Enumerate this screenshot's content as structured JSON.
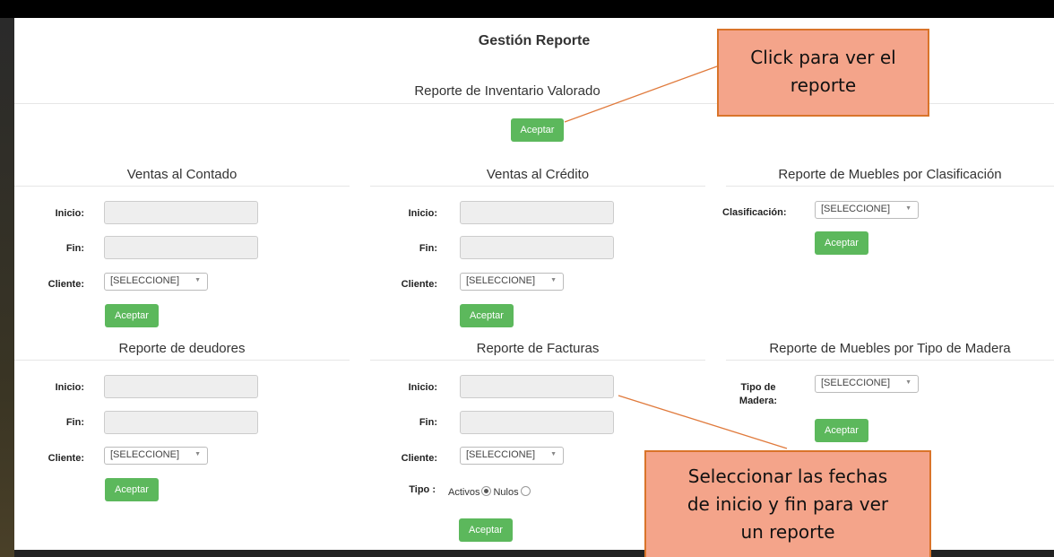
{
  "page": {
    "title": "Gestión Reporte",
    "inventario": {
      "title": "Reporte de Inventario Valorado",
      "button": "Aceptar"
    }
  },
  "sections": {
    "contado": {
      "title": "Ventas al Contado",
      "inicio": "Inicio:",
      "fin": "Fin:",
      "cliente": "Cliente:",
      "select": "[SELECCIONE]",
      "button": "Aceptar"
    },
    "credito": {
      "title": "Ventas al Crédito",
      "inicio": "Inicio:",
      "fin": "Fin:",
      "cliente": "Cliente:",
      "select": "[SELECCIONE]",
      "button": "Aceptar"
    },
    "clasificacion": {
      "title": "Reporte de Muebles por Clasificación",
      "label": "Clasificación:",
      "select": "[SELECCIONE]",
      "button": "Aceptar"
    },
    "deudores": {
      "title": "Reporte de deudores",
      "inicio": "Inicio:",
      "fin": "Fin:",
      "cliente": "Cliente:",
      "select": "[SELECCIONE]",
      "button": "Aceptar"
    },
    "facturas": {
      "title": "Reporte de Facturas",
      "inicio": "Inicio:",
      "fin": "Fin:",
      "cliente": "Cliente:",
      "select": "[SELECCIONE]",
      "tipo_label": "Tipo :",
      "activos": "Activos",
      "nulos": "Nulos",
      "button": "Aceptar"
    },
    "madera": {
      "title": "Reporte de Muebles por Tipo de Madera",
      "label_line1": "Tipo de",
      "label_line2": "Madera:",
      "select": "[SELECCIONE]",
      "button": "Aceptar"
    }
  },
  "callouts": {
    "ver_reporte": {
      "line1": "Click para ver el",
      "line2": "reporte"
    },
    "fechas": {
      "line1": "Seleccionar las fechas",
      "line2": "de inicio y fin para ver",
      "line3": "un reporte"
    }
  },
  "colors": {
    "button": "#5cb85c",
    "callout_fill": "#f4a48a",
    "callout_border": "#d9742a",
    "connector": "#e07a3c"
  }
}
